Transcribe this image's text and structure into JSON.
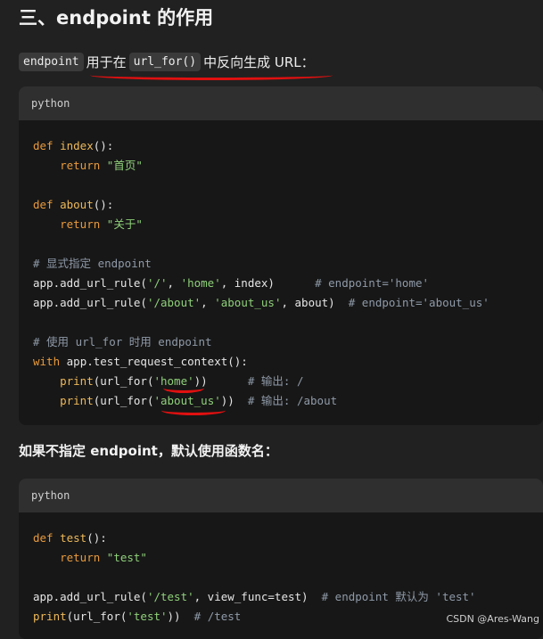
{
  "heading": "三、endpoint 的作用",
  "intro": {
    "chip1": "endpoint",
    "text1": "用于在",
    "chip2": "url_for()",
    "text2": "中反向生成 URL："
  },
  "block1": {
    "lang": "python",
    "lines": [
      {
        "indent": "",
        "parts": [
          {
            "t": "def ",
            "c": "kw"
          },
          {
            "t": "index",
            "c": "fn"
          },
          {
            "t": "():",
            "c": "p2"
          }
        ]
      },
      {
        "indent": "    ",
        "parts": [
          {
            "t": "return ",
            "c": "kw"
          },
          {
            "t": "\"首页\"",
            "c": "str"
          }
        ]
      },
      {
        "indent": "",
        "parts": []
      },
      {
        "indent": "",
        "parts": [
          {
            "t": "def ",
            "c": "kw"
          },
          {
            "t": "about",
            "c": "fn"
          },
          {
            "t": "():",
            "c": "p2"
          }
        ]
      },
      {
        "indent": "    ",
        "parts": [
          {
            "t": "return ",
            "c": "kw"
          },
          {
            "t": "\"关于\"",
            "c": "str"
          }
        ]
      },
      {
        "indent": "",
        "parts": []
      },
      {
        "indent": "",
        "parts": [
          {
            "t": "# 显式指定 endpoint",
            "c": "cm"
          }
        ]
      },
      {
        "indent": "",
        "parts": [
          {
            "t": "app.add_url_rule(",
            "c": "p2"
          },
          {
            "t": "'/'",
            "c": "str"
          },
          {
            "t": ", ",
            "c": "p2"
          },
          {
            "t": "'home'",
            "c": "str"
          },
          {
            "t": ", index)      ",
            "c": "p2"
          },
          {
            "t": "# endpoint='home'",
            "c": "cm"
          }
        ]
      },
      {
        "indent": "",
        "parts": [
          {
            "t": "app.add_url_rule(",
            "c": "p2"
          },
          {
            "t": "'/about'",
            "c": "str"
          },
          {
            "t": ", ",
            "c": "p2"
          },
          {
            "t": "'about_us'",
            "c": "str"
          },
          {
            "t": ", about)  ",
            "c": "p2"
          },
          {
            "t": "# endpoint='about_us'",
            "c": "cm"
          }
        ]
      },
      {
        "indent": "",
        "parts": []
      },
      {
        "indent": "",
        "parts": [
          {
            "t": "# 使用 url_for 时用 endpoint",
            "c": "cm"
          }
        ]
      },
      {
        "indent": "",
        "parts": [
          {
            "t": "with ",
            "c": "kw"
          },
          {
            "t": "app.test_request_context():",
            "c": "p2"
          }
        ]
      },
      {
        "indent": "    ",
        "parts": [
          {
            "t": "print",
            "c": "fn"
          },
          {
            "t": "(url_for(",
            "c": "p2"
          },
          {
            "t": "'home'",
            "c": "str"
          },
          {
            "t": "))      ",
            "c": "p2"
          },
          {
            "t": "# 输出: /",
            "c": "cm"
          }
        ]
      },
      {
        "indent": "    ",
        "parts": [
          {
            "t": "print",
            "c": "fn"
          },
          {
            "t": "(url_for(",
            "c": "p2"
          },
          {
            "t": "'about_us'",
            "c": "str"
          },
          {
            "t": "))  ",
            "c": "p2"
          },
          {
            "t": "# 输出: /about",
            "c": "cm"
          }
        ]
      }
    ]
  },
  "subheading": "如果不指定 endpoint，默认使用函数名：",
  "block2": {
    "lang": "python",
    "lines": [
      {
        "indent": "",
        "parts": [
          {
            "t": "def ",
            "c": "kw"
          },
          {
            "t": "test",
            "c": "fn"
          },
          {
            "t": "():",
            "c": "p2"
          }
        ]
      },
      {
        "indent": "    ",
        "parts": [
          {
            "t": "return ",
            "c": "kw"
          },
          {
            "t": "\"test\"",
            "c": "str"
          }
        ]
      },
      {
        "indent": "",
        "parts": []
      },
      {
        "indent": "",
        "parts": [
          {
            "t": "app.add_url_rule(",
            "c": "p2"
          },
          {
            "t": "'/test'",
            "c": "str"
          },
          {
            "t": ", view_func=test)  ",
            "c": "p2"
          },
          {
            "t": "# endpoint 默认为 'test'",
            "c": "cm"
          }
        ]
      },
      {
        "indent": "",
        "parts": [
          {
            "t": "print",
            "c": "fn"
          },
          {
            "t": "(url_for(",
            "c": "p2"
          },
          {
            "t": "'test'",
            "c": "str"
          },
          {
            "t": "))  ",
            "c": "p2"
          },
          {
            "t": "# /test",
            "c": "cm"
          }
        ]
      }
    ]
  },
  "watermark": "CSDN @Ares-Wang",
  "colors": {
    "background": "#212121",
    "code_bg": "#171717",
    "header_bg": "#2f2f2f",
    "keyword": "#e99a3c",
    "string": "#8fd07a",
    "comment": "#8f9aa8",
    "annotation": "#e01010"
  }
}
